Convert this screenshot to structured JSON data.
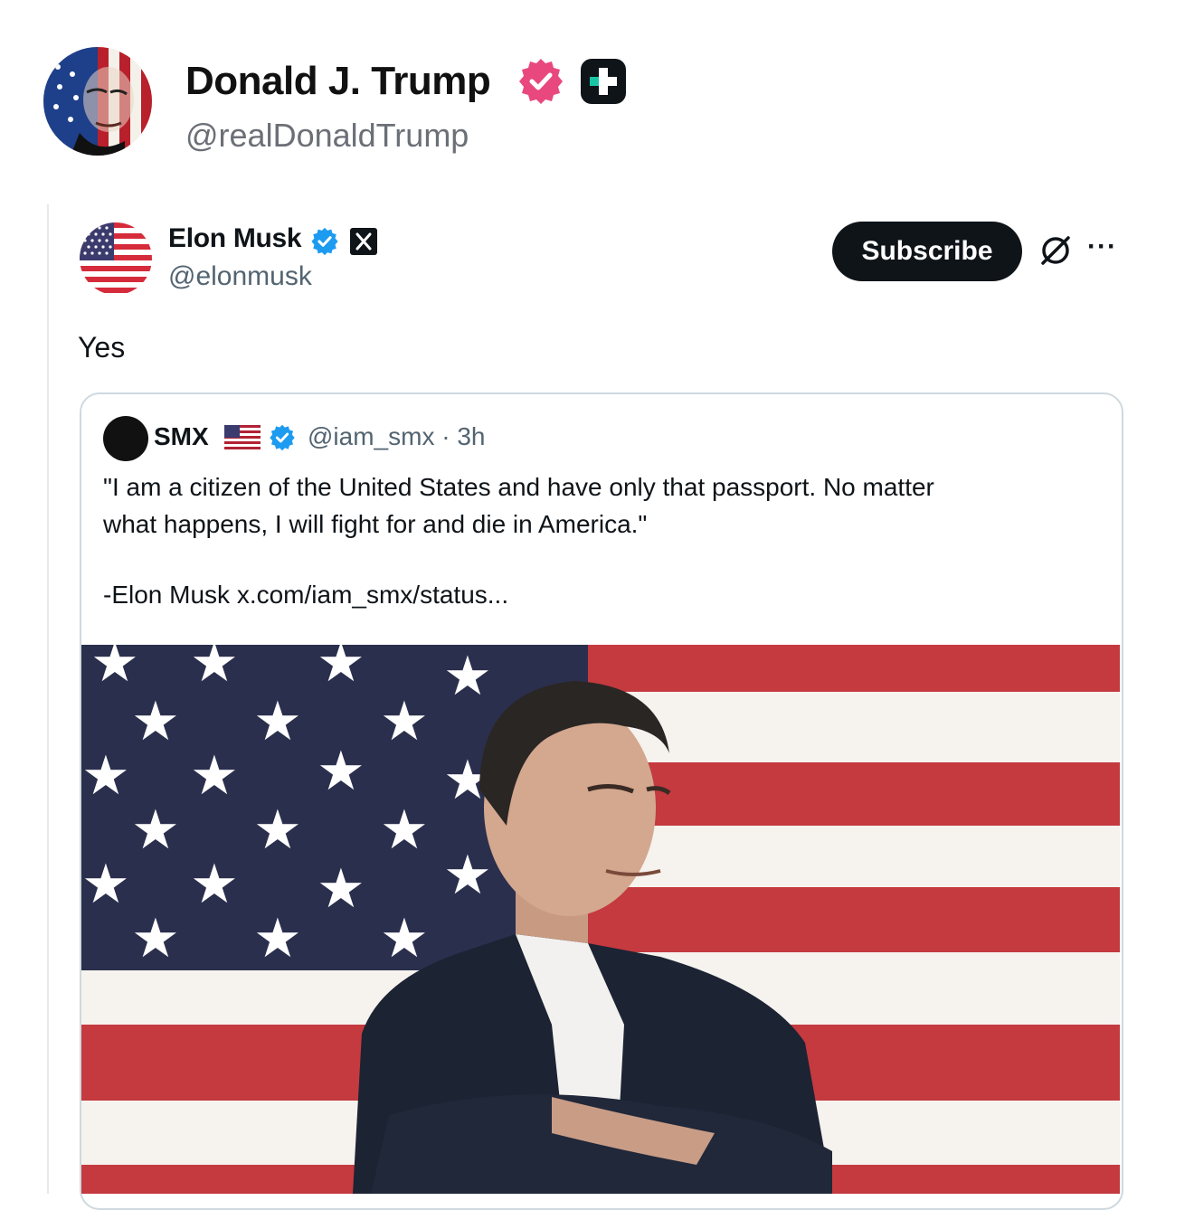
{
  "post": {
    "author_name": "Donald J. Trump",
    "author_handle": "@realDonaldTrump"
  },
  "embedded_tweet": {
    "author_name": "Elon Musk",
    "author_handle": "@elonmusk",
    "subscribe_label": "Subscribe",
    "more_label": "···",
    "text": "Yes",
    "quoted": {
      "author_name": "SMX",
      "author_handle_time": "@iam_smx · 3h",
      "line1": "\"I am a citizen of the United States and have only that passport. No matter",
      "line2": "what happens, I will fight for and die in America.\"",
      "signature": "-Elon Musk  x.com/iam_smx/status..."
    }
  },
  "colors": {
    "verified_pink": "#e8487d",
    "verified_blue": "#1d9bf0",
    "flag_red": "#b22234",
    "flag_blue": "#3c3b6e"
  },
  "icons": [
    "verified-badge-icon",
    "plus-badge-icon",
    "x-logo-icon",
    "grok-icon",
    "more-icon",
    "us-flag-icon"
  ]
}
